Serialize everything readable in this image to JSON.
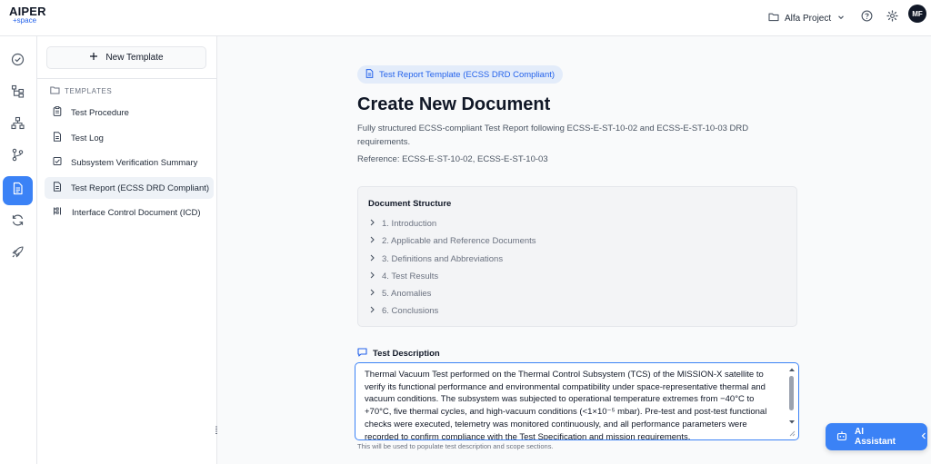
{
  "brand": {
    "line1": "AIPER",
    "line2": "+space"
  },
  "header": {
    "project_label": "Alfa Project",
    "avatar_initials": "MF",
    "icons": [
      "folder-icon",
      "chevron-down-icon",
      "help-icon",
      "gear-icon"
    ]
  },
  "rail": {
    "items": [
      {
        "icon": "check-circle-icon",
        "active": false
      },
      {
        "icon": "hierarchy-icon",
        "active": false
      },
      {
        "icon": "network-icon",
        "active": false
      },
      {
        "icon": "git-branch-icon",
        "active": false
      },
      {
        "icon": "document-icon",
        "active": true
      },
      {
        "icon": "refresh-icon",
        "active": false
      },
      {
        "icon": "rocket-icon",
        "active": false
      }
    ]
  },
  "sidebar": {
    "new_template_label": "New Template",
    "templates_heading": "TEMPLATES",
    "items": [
      {
        "label": "Test Procedure",
        "icon": "clipboard-icon",
        "active": false
      },
      {
        "label": "Test Log",
        "icon": "file-icon",
        "active": false
      },
      {
        "label": "Subsystem Verification Summary",
        "icon": "checkbox-icon",
        "active": false
      },
      {
        "label": "Test Report (ECSS DRD Compliant)",
        "icon": "file-icon",
        "active": true
      },
      {
        "label": "Interface Control Document (ICD)",
        "icon": "interface-icon",
        "active": false
      }
    ]
  },
  "main": {
    "template_pill": "Test Report Template (ECSS DRD Compliant)",
    "title": "Create New Document",
    "description": "Fully structured ECSS-compliant Test Report following ECSS-E-ST-10-02 and ECSS-E-ST-10-03 DRD requirements.",
    "reference": "Reference: ECSS-E-ST-10-02, ECSS-E-ST-10-03",
    "structure": {
      "title": "Document Structure",
      "sections": [
        "1. Introduction",
        "2. Applicable and Reference Documents",
        "3. Definitions and Abbreviations",
        "4. Test Results",
        "5. Anomalies",
        "6. Conclusions"
      ]
    },
    "test_description": {
      "label": "Test Description",
      "value": "Thermal Vacuum Test performed on the Thermal Control Subsystem (TCS) of the MISSION-X satellite to verify its functional performance and environmental compatibility under space-representative thermal and vacuum conditions. The subsystem was subjected to operational temperature extremes from −40°C to +70°C, five thermal cycles, and high-vacuum conditions (<1×10⁻⁵ mbar). Pre-test and post-test functional checks were executed, telemetry was monitored continuously, and all performance parameters were recorded to confirm compliance with the Test Specification and mission requirements.",
      "helper": "This will be used to populate test description and scope sections."
    }
  },
  "ai_assistant": {
    "label": "AI Assistant"
  },
  "colors": {
    "accent": "#3b82f6",
    "pill_bg": "#e3ecfa",
    "pill_text": "#2563eb"
  }
}
